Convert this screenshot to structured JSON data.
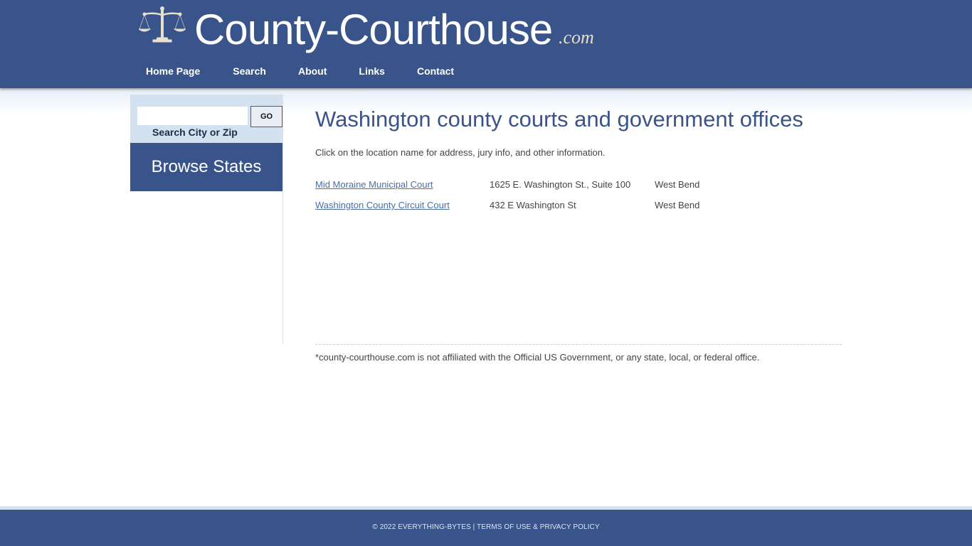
{
  "header": {
    "logo_icon": "scales-of-justice-icon",
    "site_name": "County-Courthouse",
    "site_tld": ".com",
    "nav": [
      {
        "label": "Home Page"
      },
      {
        "label": "Search"
      },
      {
        "label": "About"
      },
      {
        "label": "Links"
      },
      {
        "label": "Contact"
      }
    ]
  },
  "sidebar": {
    "search_value": "",
    "search_placeholder": "",
    "go_label": "GO",
    "search_label": "Search City or Zip",
    "browse_states_label": "Browse States"
  },
  "main": {
    "title": "Washington county courts and government offices",
    "intro": "Click on the location name for address, jury info, and other information.",
    "locations": [
      {
        "name": "Mid Moraine Municipal Court",
        "address": "1625 E. Washington St., Suite 100",
        "city": "West Bend"
      },
      {
        "name": "Washington County Circuit Court",
        "address": "432 E Washington St",
        "city": "West Bend"
      }
    ],
    "disclaimer": "*county-courthouse.com is not affiliated with the Official US Government, or any state, local, or federal office."
  },
  "footer": {
    "text": "© 2022 EVERYTHING-BYTES | TERMS OF USE & PRIVACY POLICY"
  },
  "colors": {
    "brand_blue": "#39548a",
    "light_blue": "#d3e1f1",
    "link_blue": "#4a6ea8"
  }
}
